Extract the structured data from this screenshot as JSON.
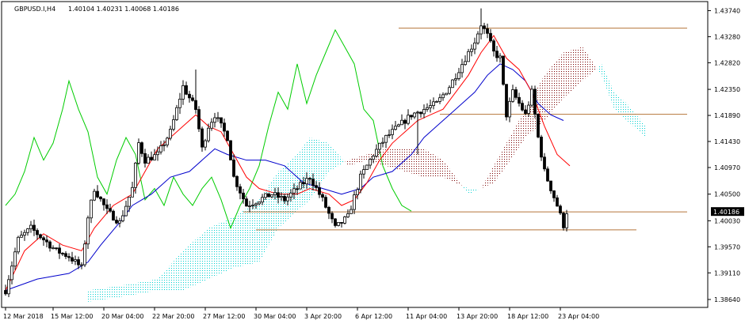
{
  "header": {
    "symbol": "GBPUSD.I,H4",
    "ohlc": "1.40104 1.40231 1.40068 1.40186"
  },
  "current_price_label": "1.40186",
  "colors": {
    "background": "#ffffff",
    "frame": "#000000",
    "candles": "#000000",
    "tenkan": "#ff0000",
    "kijun": "#0000cc",
    "chikou": "#00cc00",
    "cloud_bull": "#00d0d0",
    "cloud_bear": "#7a0000",
    "level_lines": "#b4743a"
  },
  "chart_data": {
    "type": "candlestick",
    "ylim": [
      1.385,
      1.439
    ],
    "y_ticks": [
      "1.43740",
      "1.43280",
      "1.42820",
      "1.42350",
      "1.41890",
      "1.41430",
      "1.40970",
      "1.40500",
      "1.40030",
      "1.39570",
      "1.39110",
      "1.38640"
    ],
    "y_tick_values": [
      1.4374,
      1.4328,
      1.4282,
      1.4235,
      1.4189,
      1.4143,
      1.4097,
      1.405,
      1.4003,
      1.3957,
      1.3911,
      1.3864
    ],
    "x_labels": [
      "12 Mar 2018",
      "15 Mar 12:00",
      "20 Mar 04:00",
      "22 Mar 20:00",
      "27 Mar 12:00",
      "30 Mar 04:00",
      "3 Apr 20:00",
      "6 Apr 12:00",
      "11 Apr 04:00",
      "13 Apr 20:00",
      "18 Apr 12:00",
      "23 Apr 04:00"
    ],
    "x_label_bar_index": [
      0,
      15,
      31,
      47,
      63,
      79,
      95,
      111,
      127,
      143,
      159,
      175
    ],
    "horizontal_levels": [
      {
        "price": 1.4343,
        "from_bar": 124,
        "to_bar": 215
      },
      {
        "price": 1.4191,
        "from_bar": 137,
        "to_bar": 215
      },
      {
        "price": 1.40186,
        "from_bar": 75,
        "to_bar": 215
      },
      {
        "price": 1.3987,
        "from_bar": 79,
        "to_bar": 199
      }
    ],
    "current_price": 1.40186,
    "anchors": [
      [
        0,
        1.388
      ],
      [
        4,
        1.397
      ],
      [
        8,
        1.399
      ],
      [
        12,
        1.397
      ],
      [
        16,
        1.395
      ],
      [
        20,
        1.394
      ],
      [
        24,
        1.392
      ],
      [
        26,
        1.401
      ],
      [
        28,
        1.406
      ],
      [
        32,
        1.402
      ],
      [
        36,
        1.4
      ],
      [
        40,
        1.406
      ],
      [
        42,
        1.414
      ],
      [
        44,
        1.411
      ],
      [
        48,
        1.412
      ],
      [
        52,
        1.416
      ],
      [
        56,
        1.424
      ],
      [
        60,
        1.42
      ],
      [
        62,
        1.413
      ],
      [
        64,
        1.417
      ],
      [
        66,
        1.419
      ],
      [
        70,
        1.415
      ],
      [
        72,
        1.408
      ],
      [
        76,
        1.403
      ],
      [
        80,
        1.404
      ],
      [
        84,
        1.405
      ],
      [
        88,
        1.404
      ],
      [
        92,
        1.406
      ],
      [
        96,
        1.408
      ],
      [
        100,
        1.404
      ],
      [
        104,
        1.399
      ],
      [
        108,
        1.401
      ],
      [
        112,
        1.408
      ],
      [
        116,
        1.412
      ],
      [
        120,
        1.415
      ],
      [
        124,
        1.417
      ],
      [
        128,
        1.419
      ],
      [
        132,
        1.42
      ],
      [
        136,
        1.421
      ],
      [
        140,
        1.424
      ],
      [
        144,
        1.428
      ],
      [
        148,
        1.432
      ],
      [
        150,
        1.435
      ],
      [
        152,
        1.433
      ],
      [
        154,
        1.43
      ],
      [
        156,
        1.429
      ],
      [
        158,
        1.419
      ],
      [
        160,
        1.423
      ],
      [
        162,
        1.421
      ],
      [
        164,
        1.419
      ],
      [
        166,
        1.423
      ],
      [
        168,
        1.415
      ],
      [
        170,
        1.409
      ],
      [
        172,
        1.406
      ],
      [
        174,
        1.403
      ],
      [
        176,
        1.3995
      ],
      [
        177,
        1.4019
      ]
    ],
    "tenkan_sen": [
      [
        0,
        1.388
      ],
      [
        6,
        1.395
      ],
      [
        12,
        1.398
      ],
      [
        18,
        1.396
      ],
      [
        24,
        1.395
      ],
      [
        28,
        1.399
      ],
      [
        34,
        1.403
      ],
      [
        40,
        1.405
      ],
      [
        44,
        1.409
      ],
      [
        48,
        1.413
      ],
      [
        52,
        1.415
      ],
      [
        56,
        1.417
      ],
      [
        60,
        1.419
      ],
      [
        64,
        1.417
      ],
      [
        68,
        1.416
      ],
      [
        72,
        1.412
      ],
      [
        76,
        1.408
      ],
      [
        80,
        1.406
      ],
      [
        86,
        1.405
      ],
      [
        92,
        1.405
      ],
      [
        96,
        1.406
      ],
      [
        102,
        1.405
      ],
      [
        106,
        1.403
      ],
      [
        110,
        1.404
      ],
      [
        114,
        1.407
      ],
      [
        118,
        1.411
      ],
      [
        122,
        1.414
      ],
      [
        126,
        1.416
      ],
      [
        130,
        1.418
      ],
      [
        134,
        1.419
      ],
      [
        138,
        1.42
      ],
      [
        142,
        1.423
      ],
      [
        146,
        1.426
      ],
      [
        150,
        1.43
      ],
      [
        154,
        1.433
      ],
      [
        158,
        1.429
      ],
      [
        162,
        1.427
      ],
      [
        166,
        1.423
      ],
      [
        170,
        1.417
      ],
      [
        174,
        1.412
      ],
      [
        178,
        1.41
      ]
    ],
    "kijun_sen": [
      [
        0,
        1.388
      ],
      [
        10,
        1.39
      ],
      [
        20,
        1.391
      ],
      [
        26,
        1.393
      ],
      [
        30,
        1.396
      ],
      [
        36,
        1.4
      ],
      [
        40,
        1.403
      ],
      [
        46,
        1.405
      ],
      [
        52,
        1.408
      ],
      [
        58,
        1.409
      ],
      [
        62,
        1.411
      ],
      [
        66,
        1.413
      ],
      [
        70,
        1.412
      ],
      [
        76,
        1.411
      ],
      [
        82,
        1.411
      ],
      [
        88,
        1.41
      ],
      [
        94,
        1.407
      ],
      [
        100,
        1.406
      ],
      [
        106,
        1.405
      ],
      [
        112,
        1.406
      ],
      [
        116,
        1.408
      ],
      [
        122,
        1.409
      ],
      [
        128,
        1.412
      ],
      [
        132,
        1.415
      ],
      [
        136,
        1.417
      ],
      [
        140,
        1.419
      ],
      [
        144,
        1.421
      ],
      [
        148,
        1.423
      ],
      [
        152,
        1.426
      ],
      [
        156,
        1.428
      ],
      [
        160,
        1.427
      ],
      [
        164,
        1.425
      ],
      [
        168,
        1.421
      ],
      [
        172,
        1.419
      ],
      [
        176,
        1.418
      ]
    ],
    "chikou_span": [
      [
        0,
        1.403
      ],
      [
        3,
        1.405
      ],
      [
        6,
        1.409
      ],
      [
        9,
        1.415
      ],
      [
        12,
        1.411
      ],
      [
        15,
        1.414
      ],
      [
        18,
        1.42
      ],
      [
        20,
        1.425
      ],
      [
        23,
        1.42
      ],
      [
        26,
        1.416
      ],
      [
        29,
        1.408
      ],
      [
        32,
        1.405
      ],
      [
        35,
        1.411
      ],
      [
        38,
        1.415
      ],
      [
        41,
        1.412
      ],
      [
        44,
        1.404
      ],
      [
        47,
        1.406
      ],
      [
        50,
        1.403
      ],
      [
        53,
        1.408
      ],
      [
        56,
        1.405
      ],
      [
        59,
        1.403
      ],
      [
        62,
        1.406
      ],
      [
        65,
        1.408
      ],
      [
        68,
        1.404
      ],
      [
        71,
        1.399
      ],
      [
        74,
        1.403
      ],
      [
        77,
        1.406
      ],
      [
        80,
        1.41
      ],
      [
        83,
        1.417
      ],
      [
        86,
        1.423
      ],
      [
        89,
        1.42
      ],
      [
        92,
        1.428
      ],
      [
        95,
        1.421
      ],
      [
        98,
        1.426
      ],
      [
        101,
        1.43
      ],
      [
        104,
        1.434
      ],
      [
        107,
        1.431
      ],
      [
        110,
        1.428
      ],
      [
        113,
        1.42
      ],
      [
        116,
        1.418
      ],
      [
        119,
        1.41
      ],
      [
        122,
        1.406
      ],
      [
        125,
        1.403
      ],
      [
        128,
        1.402
      ]
    ],
    "cloud": {
      "senkou_a": [
        [
          0,
          1.388
        ],
        [
          12,
          1.389
        ],
        [
          22,
          1.39
        ],
        [
          30,
          1.395
        ],
        [
          38,
          1.399
        ],
        [
          46,
          1.401
        ],
        [
          54,
          1.404
        ],
        [
          60,
          1.409
        ],
        [
          66,
          1.412
        ],
        [
          70,
          1.415
        ],
        [
          76,
          1.414
        ],
        [
          82,
          1.41
        ],
        [
          88,
          1.411
        ],
        [
          94,
          1.41
        ],
        [
          100,
          1.409
        ],
        [
          106,
          1.408
        ],
        [
          112,
          1.408
        ],
        [
          116,
          1.407
        ],
        [
          120,
          1.406
        ],
        [
          124,
          1.406
        ],
        [
          128,
          1.407
        ],
        [
          132,
          1.41
        ],
        [
          138,
          1.415
        ],
        [
          144,
          1.418
        ],
        [
          150,
          1.422
        ],
        [
          156,
          1.425
        ],
        [
          162,
          1.428
        ],
        [
          166,
          1.423
        ],
        [
          170,
          1.421
        ],
        [
          176,
          1.417
        ]
      ],
      "senkou_b": [
        [
          0,
          1.386
        ],
        [
          12,
          1.387
        ],
        [
          22,
          1.388
        ],
        [
          30,
          1.388
        ],
        [
          38,
          1.39
        ],
        [
          46,
          1.392
        ],
        [
          54,
          1.393
        ],
        [
          60,
          1.399
        ],
        [
          66,
          1.402
        ],
        [
          70,
          1.404
        ],
        [
          76,
          1.409
        ],
        [
          82,
          1.411
        ],
        [
          88,
          1.412
        ],
        [
          94,
          1.413
        ],
        [
          100,
          1.413
        ],
        [
          106,
          1.413
        ],
        [
          112,
          1.411
        ],
        [
          116,
          1.408
        ],
        [
          120,
          1.405
        ],
        [
          124,
          1.406
        ],
        [
          128,
          1.41
        ],
        [
          132,
          1.414
        ],
        [
          138,
          1.42
        ],
        [
          144,
          1.426
        ],
        [
          150,
          1.43
        ],
        [
          156,
          1.431
        ],
        [
          162,
          1.426
        ],
        [
          166,
          1.42
        ],
        [
          170,
          1.418
        ],
        [
          176,
          1.415
        ]
      ],
      "bar_offset": 26
    },
    "volatility_spikes": [
      [
        60,
        1.427
      ],
      [
        130,
        1.412
      ],
      [
        150,
        1.4378
      ],
      [
        158,
        1.4205
      ]
    ]
  }
}
